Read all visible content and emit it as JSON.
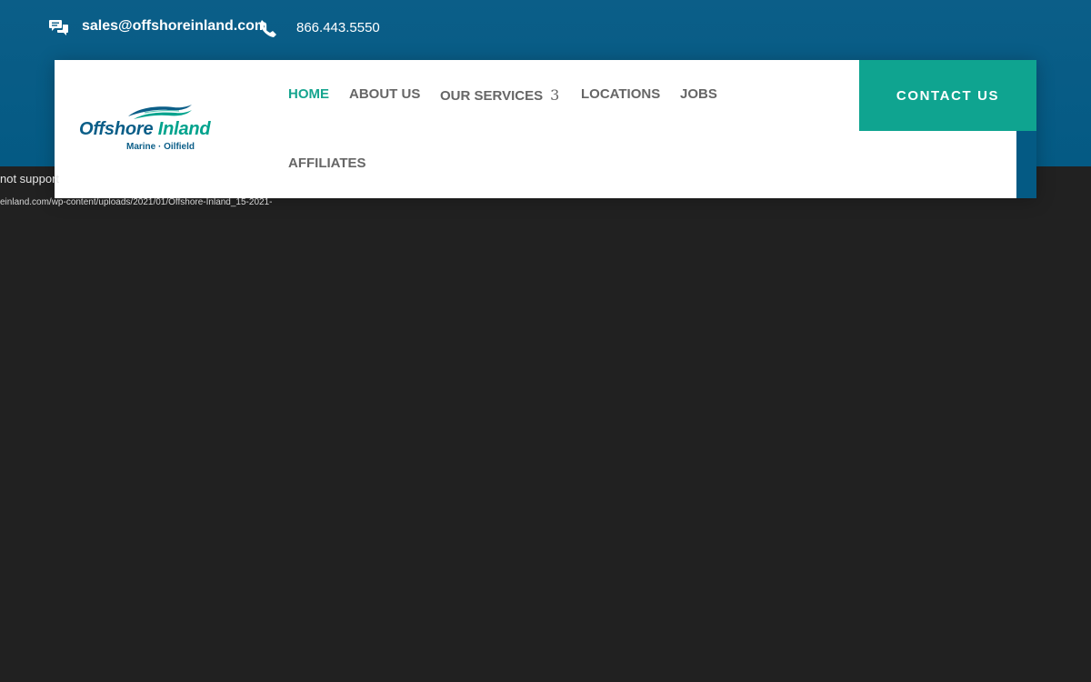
{
  "top_bar": {
    "email": "sales@offshoreinland.com",
    "phone": "866.443.5550",
    "email_icon": "chat-bubbles-icon",
    "phone_icon": "phone-icon",
    "background_color": "#045a84"
  },
  "logo": {
    "name_part1": "Offshore",
    "name_part2": "Inland",
    "tagline": "Marine · Oilfield"
  },
  "nav": {
    "items": [
      {
        "label": "HOME",
        "active": true
      },
      {
        "label": "ABOUT US",
        "active": false
      },
      {
        "label": "OUR SERVICES",
        "active": false,
        "dropdown_glyph": "3"
      },
      {
        "label": "LOCATIONS",
        "active": false
      },
      {
        "label": "JOBS",
        "active": false
      },
      {
        "label": "AFFILIATES",
        "active": false
      }
    ],
    "active_color": "#16a58f",
    "cta_label": "CONTACT US",
    "cta_color": "#0fa490"
  },
  "error_text": {
    "line1": "not support",
    "line2": "einland.com/wp-content/uploads/2021/01/Offshore-Inland_15-2021-"
  }
}
